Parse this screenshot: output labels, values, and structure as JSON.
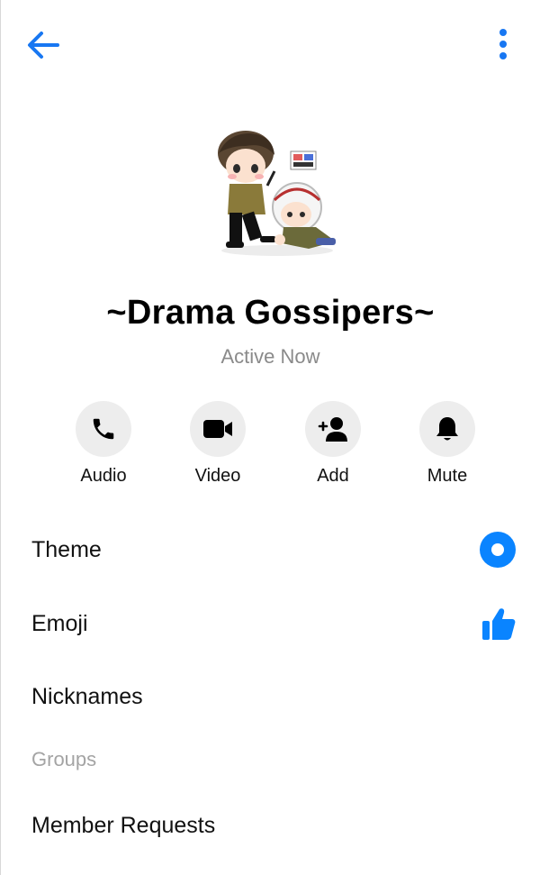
{
  "header": {
    "back_icon": "arrow-left-icon",
    "more_icon": "more-vertical-icon",
    "accent_color": "#1877f2"
  },
  "profile": {
    "name": "~Drama Gossipers~",
    "status": "Active Now",
    "avatar": "group-avatar-illustration"
  },
  "actions": [
    {
      "label": "Audio",
      "icon": "phone-icon"
    },
    {
      "label": "Video",
      "icon": "video-camera-icon"
    },
    {
      "label": "Add",
      "icon": "add-person-icon"
    },
    {
      "label": "Mute",
      "icon": "bell-icon"
    }
  ],
  "settings": {
    "theme": {
      "label": "Theme",
      "icon": "theme-circle-icon"
    },
    "emoji": {
      "label": "Emoji",
      "icon": "thumbs-up-icon"
    },
    "nicknames": {
      "label": "Nicknames"
    }
  },
  "groups": {
    "title": "Groups",
    "member_requests": {
      "label": "Member Requests"
    }
  }
}
